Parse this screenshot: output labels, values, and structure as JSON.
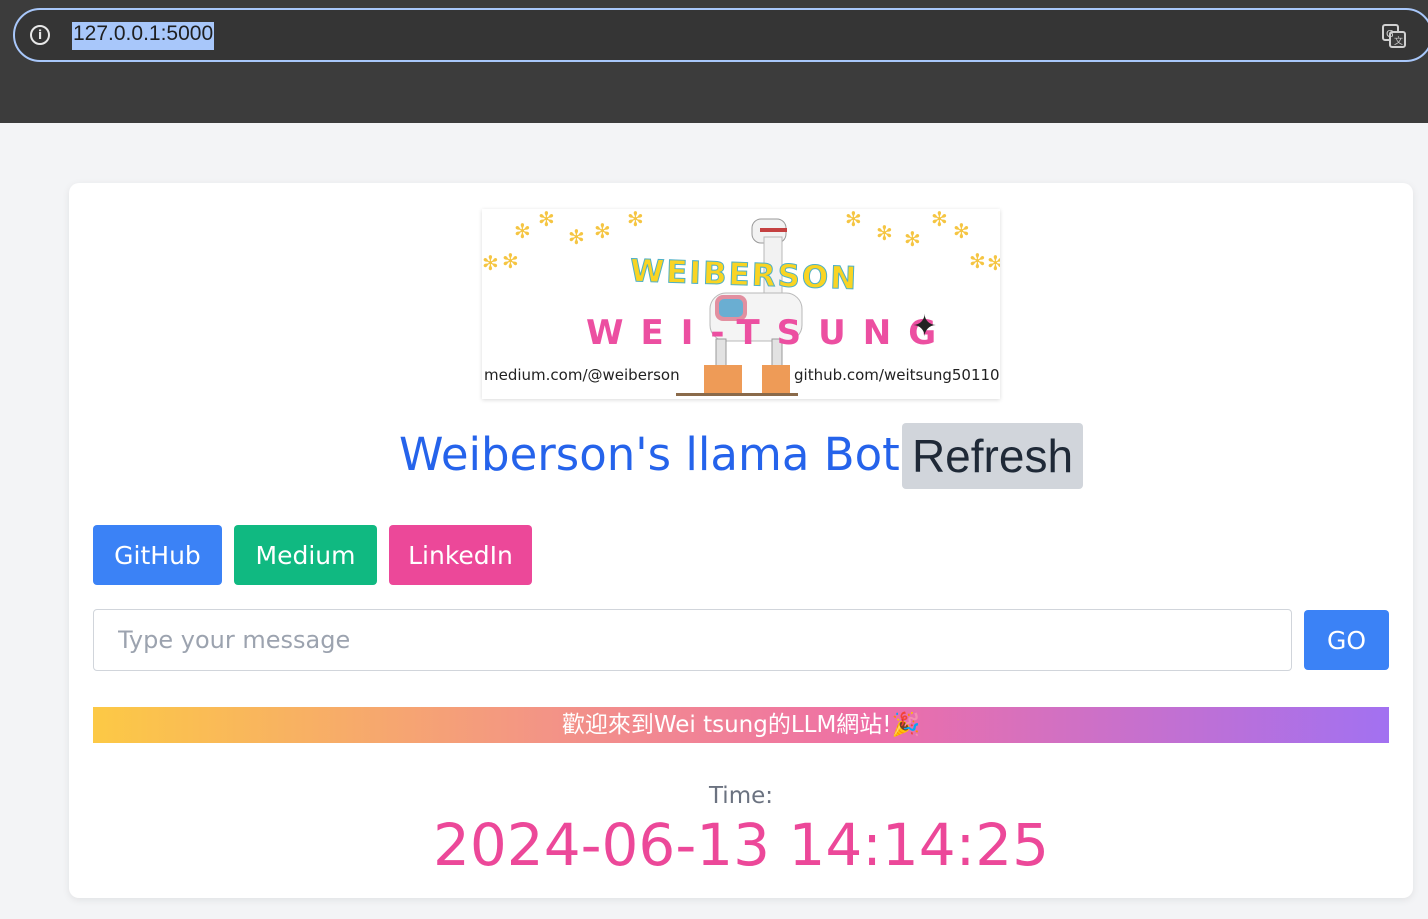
{
  "browser": {
    "url": "127.0.0.1:5000",
    "info_icon": "i"
  },
  "banner": {
    "logo_top": "WEIBERSON",
    "logo_mid": "WEI-TSUNG",
    "sparkle": "✦",
    "url_left": "medium.com/@weiberson",
    "url_right": "github.com/weitsung50110"
  },
  "header": {
    "title": "Weiberson's llama Bot",
    "refresh_label": "Refresh"
  },
  "links": {
    "github": "GitHub",
    "medium": "Medium",
    "linkedin": "LinkedIn"
  },
  "chat": {
    "placeholder": "Type your message",
    "value": "",
    "go_label": "GO"
  },
  "welcome": {
    "text": "歡迎來到Wei tsung的LLM網站!🎉"
  },
  "clock": {
    "label": "Time:",
    "value": "2024-06-13 14:14:25"
  },
  "colors": {
    "title": "#2563eb",
    "github": "#3b82f6",
    "medium": "#10b981",
    "linkedin": "#ec4899",
    "go": "#3b82f6",
    "time_value": "#ec4899"
  },
  "icons": {
    "info": "info-icon",
    "translate": "translate-icon",
    "sparkle": "sparkle-icon"
  }
}
